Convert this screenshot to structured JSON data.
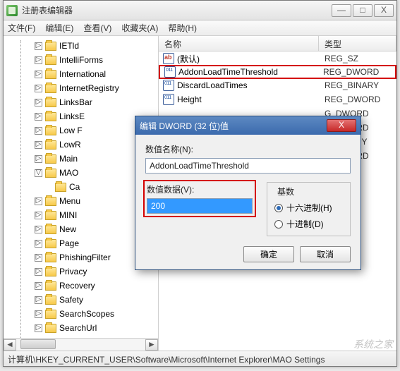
{
  "window": {
    "title": "注册表编辑器",
    "min": "—",
    "max": "□",
    "close": "X"
  },
  "menu": {
    "file": "文件(F)",
    "edit": "编辑(E)",
    "view": "查看(V)",
    "fav": "收藏夹(A)",
    "help": "帮助(H)"
  },
  "tree": [
    "IETld",
    "IntelliForms",
    "International",
    "InternetRegistry",
    "LinksBar",
    "LinksE",
    "Low F",
    "LowR",
    "Main",
    "MAO",
    "Ca",
    "Menu",
    "MINI",
    "New",
    "Page",
    "PhishingFilter",
    "Privacy",
    "Recovery",
    "Safety",
    "SearchScopes",
    "SearchUrl"
  ],
  "list": {
    "col_name": "名称",
    "col_type": "类型",
    "rows": [
      {
        "name": "(默认)",
        "type": "REG_SZ",
        "icon": "sz"
      },
      {
        "name": "AddonLoadTimeThreshold",
        "type": "REG_DWORD",
        "icon": "dw",
        "highlight": true
      },
      {
        "name": "DiscardLoadTimes",
        "type": "REG_BINARY",
        "icon": "dw"
      },
      {
        "name": "Height",
        "type": "REG_DWORD",
        "icon": "dw"
      },
      {
        "name": "",
        "type": "G_DWORD",
        "icon": ""
      },
      {
        "name": "",
        "type": "G_DWORD",
        "icon": ""
      },
      {
        "name": "",
        "type": "G_BINARY",
        "icon": ""
      },
      {
        "name": "",
        "type": "G_DWORD",
        "icon": ""
      }
    ]
  },
  "dialog": {
    "title": "编辑 DWORD (32 位)值",
    "name_label": "数值名称(N):",
    "name_value": "AddonLoadTimeThreshold",
    "data_label": "数值数据(V):",
    "data_value": "200",
    "base_label": "基数",
    "radio_hex": "十六进制(H)",
    "radio_dec": "十进制(D)",
    "ok": "确定",
    "cancel": "取消",
    "close": "X"
  },
  "statusbar": "计算机\\HKEY_CURRENT_USER\\Software\\Microsoft\\Internet Explorer\\MAO Settings",
  "watermark": "系统之家",
  "chevrons": {
    "left": "◄",
    "right": "►",
    "tri_right": "▷",
    "tri_down": "▽"
  }
}
